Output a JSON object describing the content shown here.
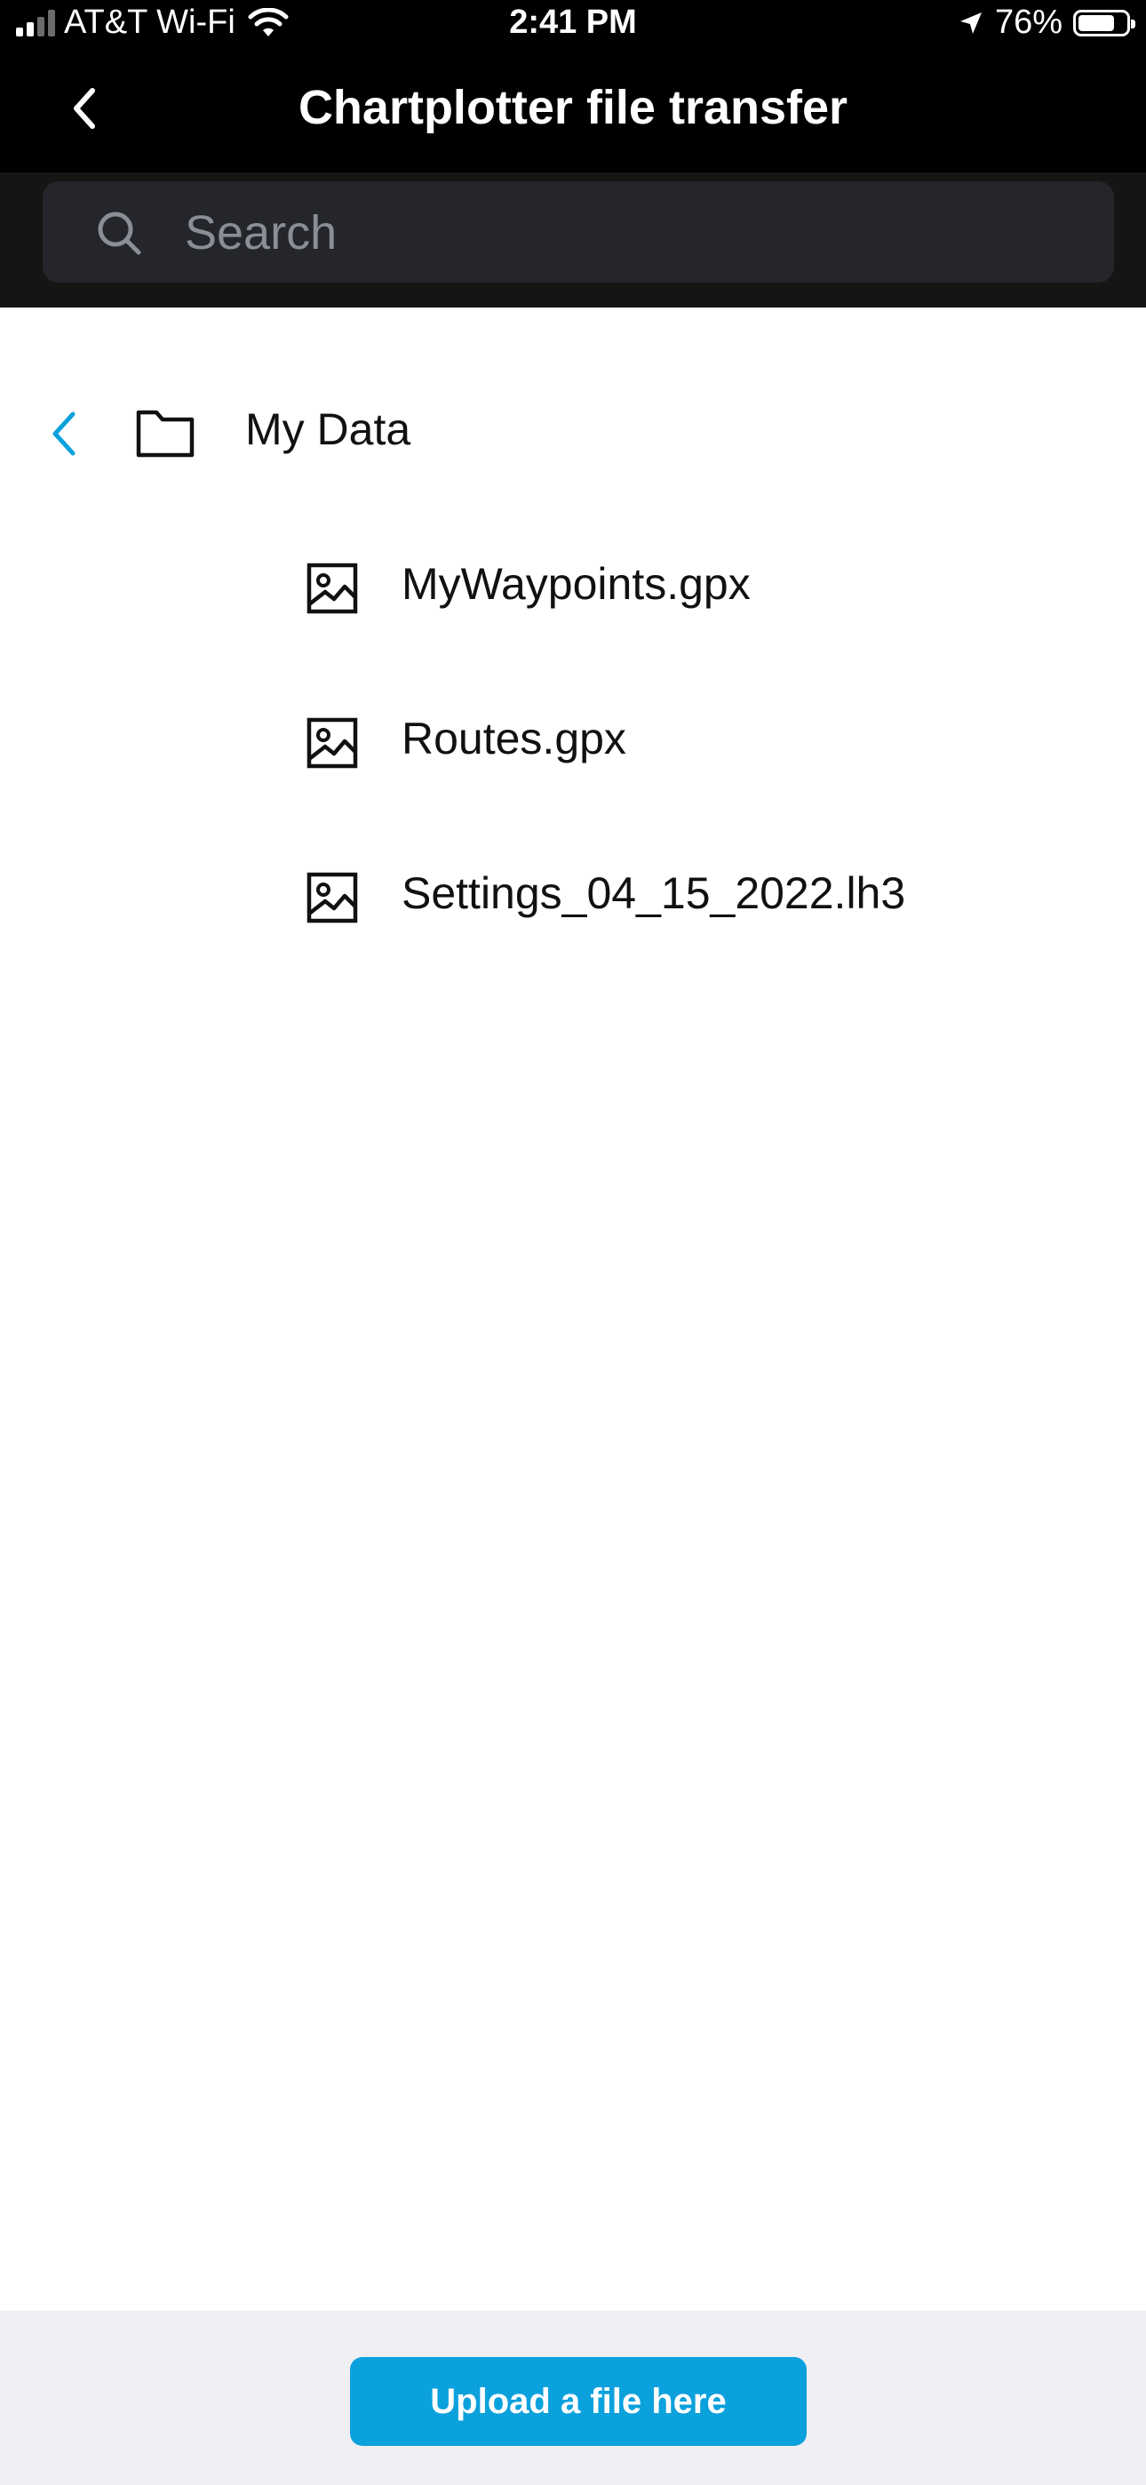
{
  "status_bar": {
    "carrier": "AT&T Wi-Fi",
    "time": "2:41 PM",
    "battery": "76%",
    "battery_level": 0.76,
    "icons": [
      "signal-icon",
      "wifi-icon",
      "location-arrow-icon",
      "battery-icon"
    ]
  },
  "header": {
    "title": "Chartplotter file transfer",
    "back_icon": "chevron-left-icon"
  },
  "search": {
    "placeholder": "Search",
    "value": ""
  },
  "folder": {
    "name": "My Data",
    "back_icon": "chevron-left-icon",
    "icon": "folder-icon",
    "accent_color": "#0ba1dd"
  },
  "files": [
    {
      "name": "MyWaypoints.gpx",
      "icon": "image-file-icon"
    },
    {
      "name": "Routes.gpx",
      "icon": "image-file-icon"
    },
    {
      "name": "Settings_04_15_2022.lh3",
      "icon": "image-file-icon"
    }
  ],
  "footer": {
    "upload_label": "Upload a file here",
    "upload_color": "#0ba1dd"
  }
}
